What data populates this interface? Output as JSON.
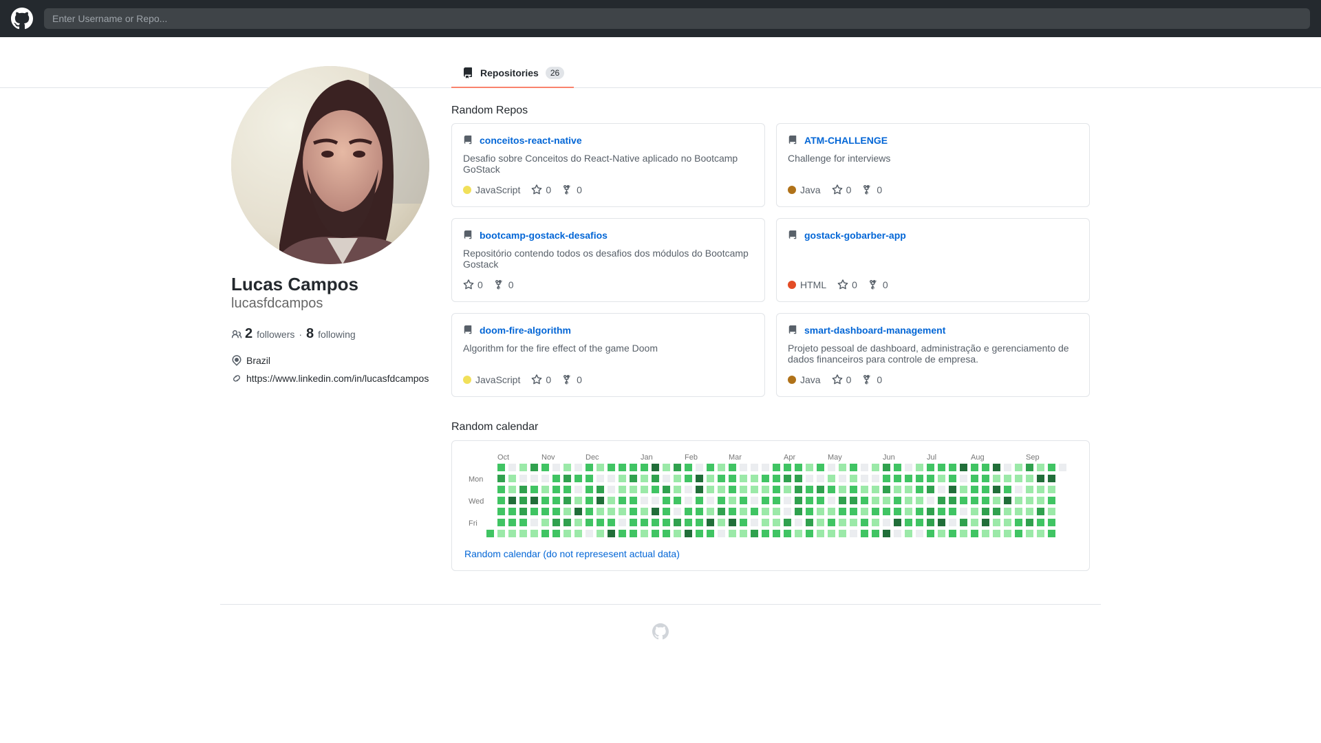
{
  "header": {
    "search_placeholder": "Enter Username or Repo..."
  },
  "tabs": {
    "repositories_label": "Repositories",
    "repositories_count": "26"
  },
  "profile": {
    "name": "Lucas Campos",
    "login": "lucasfdcampos",
    "followers_count": "2",
    "followers_label": "followers",
    "separator": "·",
    "following_count": "8",
    "following_label": "following",
    "location": "Brazil",
    "website": "https://www.linkedin.com/in/lucasfdcampos"
  },
  "repos_section": {
    "title": "Random Repos",
    "repos": [
      {
        "name": "conceitos-react-native",
        "description": "Desafio sobre Conceitos do React-Native aplicado no Bootcamp GoStack",
        "language": "JavaScript",
        "language_color": "#f1e05a",
        "stars": "0",
        "forks": "0"
      },
      {
        "name": "ATM-CHALLENGE",
        "description": "Challenge for interviews",
        "language": "Java",
        "language_color": "#b07219",
        "stars": "0",
        "forks": "0"
      },
      {
        "name": "bootcamp-gostack-desafios",
        "description": "Repositório contendo todos os desafios dos módulos do Bootcamp Gostack",
        "language": "",
        "language_color": "",
        "stars": "0",
        "forks": "0"
      },
      {
        "name": "gostack-gobarber-app",
        "description": "",
        "language": "HTML",
        "language_color": "#e34c26",
        "stars": "0",
        "forks": "0"
      },
      {
        "name": "doom-fire-algorithm",
        "description": "Algorithm for the fire effect of the game Doom",
        "language": "JavaScript",
        "language_color": "#f1e05a",
        "stars": "0",
        "forks": "0"
      },
      {
        "name": "smart-dashboard-management",
        "description": "Projeto pessoal de dashboard, administração e gerenciamento de dados financeiros para controle de empresa.",
        "language": "Java",
        "language_color": "#b07219",
        "stars": "0",
        "forks": "0"
      }
    ]
  },
  "calendar": {
    "title": "Random calendar",
    "months": [
      "Oct",
      "Nov",
      "Dec",
      "Jan",
      "Feb",
      "Mar",
      "Apr",
      "May",
      "Jun",
      "Jul",
      "Aug",
      "Sep"
    ],
    "day_labels": [
      "Mon",
      "Wed",
      "Fri"
    ],
    "note": "Random calendar (do not represesent actual data)",
    "colors": [
      "#ebedf0",
      "#9be9a8",
      "#40c463",
      "#30a14e",
      "#216e39"
    ]
  }
}
